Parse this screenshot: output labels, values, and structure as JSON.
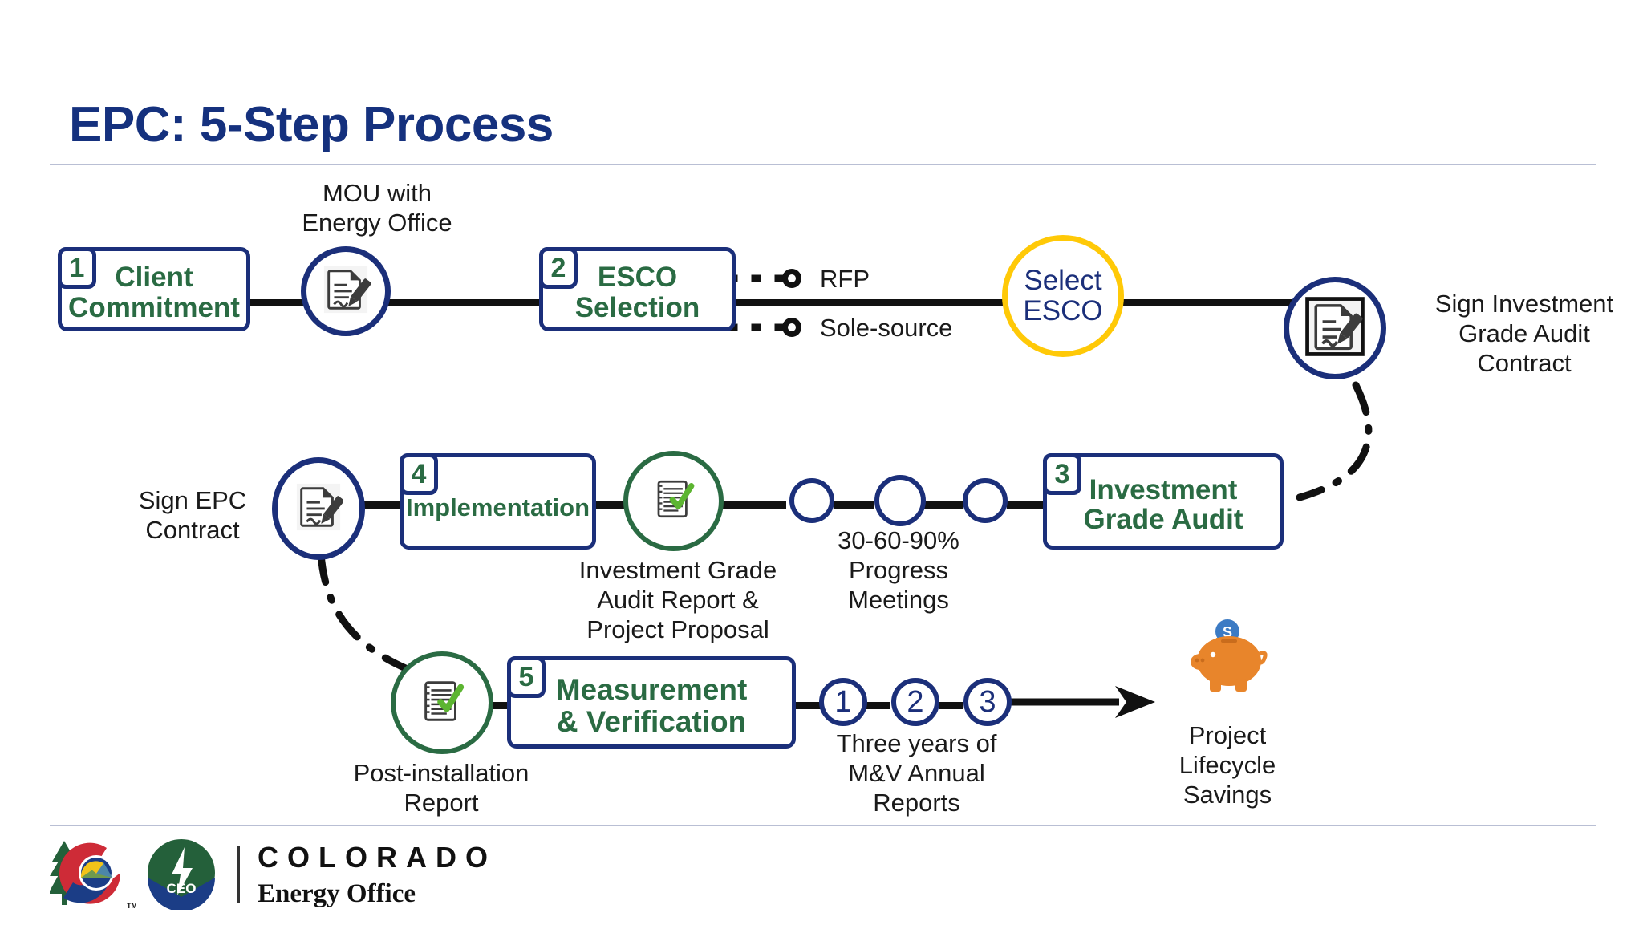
{
  "slide": {
    "title": "EPC: 5-Step Process",
    "accent_navy": "#1B2F7A",
    "accent_green": "#2A6B43",
    "accent_gold": "#FFC907",
    "accent_orange": "#E8852B"
  },
  "steps": [
    {
      "number": "1",
      "label": "Client\nCommitment"
    },
    {
      "number": "2",
      "label": "ESCO\nSelection"
    },
    {
      "number": "3",
      "label": "Investment\nGrade Audit"
    },
    {
      "number": "4",
      "label": "Implementation"
    },
    {
      "number": "5",
      "label": "Measurement\n& Verification"
    }
  ],
  "nodes": {
    "select_esco": "Select\nESCO",
    "year_circles": [
      "1",
      "2",
      "3"
    ],
    "progress_circles": [
      "",
      "",
      ""
    ]
  },
  "captions": {
    "mou": "MOU with\nEnergy Office",
    "sign_iga_contract": "Sign Investment\nGrade Audit\nContract",
    "sign_epc_contract": "Sign EPC\nContract",
    "iga_report": "Investment Grade\nAudit Report &\nProject Proposal",
    "progress_meetings": "30-60-90%\nProgress\nMeetings",
    "post_install": "Post-installation\nReport",
    "three_years": "Three years of\nM&V Annual\nReports",
    "lifecycle_savings": "Project\nLifecycle\nSavings"
  },
  "branches": [
    {
      "label": "RFP"
    },
    {
      "label": "Sole-source"
    }
  ],
  "icons": {
    "mou_doc": "document-signature-icon",
    "iga_contract_doc": "document-signature-icon",
    "epc_contract_doc": "document-signature-icon",
    "iga_report": "checklist-check-icon",
    "post_install_report": "checklist-check-icon",
    "savings": "piggy-bank-icon"
  },
  "footer": {
    "wordmark_top": "COLORADO",
    "wordmark_bottom": "Energy Office",
    "ceo_mark": "CEO",
    "trademark": "TM"
  }
}
